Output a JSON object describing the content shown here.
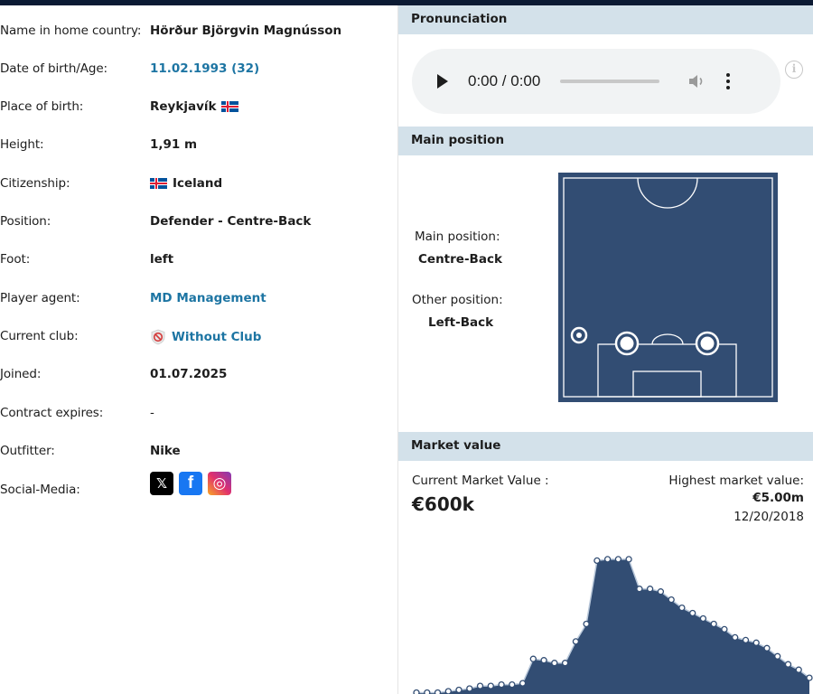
{
  "details": {
    "rows": [
      {
        "label": "Name in home country:",
        "value": "Hörður Björgvin Magnússon"
      },
      {
        "label": "Date of birth/Age:",
        "value": "11.02.1993 (32)"
      },
      {
        "label": "Place of birth:",
        "value": "Reykjavík"
      },
      {
        "label": "Height:",
        "value": "1,91 m"
      },
      {
        "label": "Citizenship:",
        "value": "Iceland"
      },
      {
        "label": "Position:",
        "value": "Defender - Centre-Back"
      },
      {
        "label": "Foot:",
        "value": "left"
      },
      {
        "label": "Player agent:",
        "value": "MD Management"
      },
      {
        "label": "Current club:",
        "value": "Without Club"
      },
      {
        "label": "Joined:",
        "value": "01.07.2025"
      },
      {
        "label": "Contract expires:",
        "value": "-"
      },
      {
        "label": "Outfitter:",
        "value": "Nike"
      },
      {
        "label": "Social-Media:",
        "value": ""
      }
    ],
    "flag_colors": {
      "blue": "#02529c",
      "white": "#ffffff",
      "red": "#dc1e35"
    },
    "social": [
      {
        "icon": "x-icon",
        "glyph": "𝕏",
        "color": "#000000"
      },
      {
        "icon": "facebook-icon",
        "glyph": "f",
        "color": "#1877f2"
      },
      {
        "icon": "instagram-icon",
        "glyph": "◎",
        "color": "#d6249f"
      }
    ]
  },
  "pronunciation": {
    "title": "Pronunciation",
    "time": "0:00 / 0:00",
    "info_glyph": "i"
  },
  "main_position": {
    "title": "Main position",
    "main_label": "Main position:",
    "main_value": "Centre-Back",
    "other_label": "Other position:",
    "other_value": "Left-Back",
    "pitch_color": "#324d73"
  },
  "market_value": {
    "title": "Market value",
    "current_label": "Current Market Value :",
    "current_value": "€600k",
    "highest_label": "Highest market value:",
    "highest_value": "€5.00m",
    "highest_date": "12/20/2018"
  },
  "chart_data": {
    "type": "area",
    "ylim": [
      0,
      5.5
    ],
    "values": [
      0.05,
      0.05,
      0.05,
      0.1,
      0.15,
      0.2,
      0.3,
      0.3,
      0.35,
      0.35,
      0.4,
      1.3,
      1.25,
      1.15,
      1.15,
      1.95,
      2.6,
      4.95,
      5.0,
      5.0,
      5.0,
      3.9,
      3.9,
      3.8,
      3.5,
      3.2,
      3.0,
      2.8,
      2.6,
      2.4,
      2.1,
      2.0,
      1.9,
      1.7,
      1.4,
      1.1,
      0.9,
      0.6
    ],
    "fill_color": "#324d73",
    "line_color": "#b9c8da"
  }
}
